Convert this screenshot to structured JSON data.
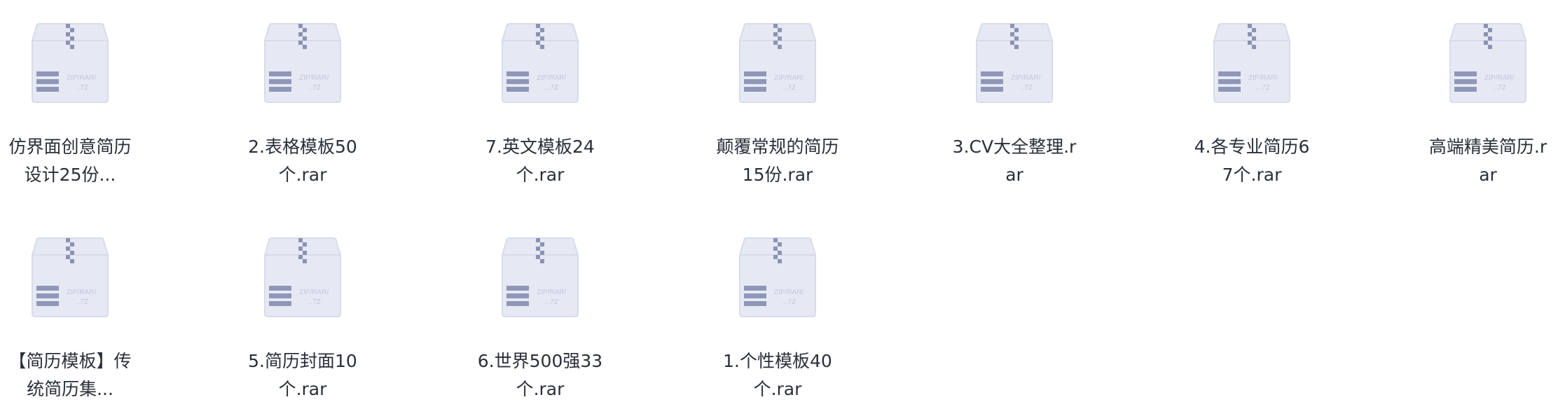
{
  "files": [
    {
      "name": "仿界面创意简历设计25份...",
      "icon": "archive-zip-icon",
      "icon_text": "ZIP/RAR/\n...7Z"
    },
    {
      "name": "2.表格模板50个.rar",
      "icon": "archive-zip-icon",
      "icon_text": "ZIP/RAR/\n...7Z"
    },
    {
      "name": "7.英文模板24个.rar",
      "icon": "archive-zip-icon",
      "icon_text": "ZIP/RAR/\n...7Z"
    },
    {
      "name": "颠覆常规的简历15份.rar",
      "icon": "archive-zip-icon",
      "icon_text": "ZIP/RAR/\n...7Z"
    },
    {
      "name": "3.CV大全整理.rar",
      "icon": "archive-zip-icon",
      "icon_text": "ZIP/RAR/\n...7Z"
    },
    {
      "name": "4.各专业简历67个.rar",
      "icon": "archive-zip-icon",
      "icon_text": "ZIP/RAR/\n...7Z"
    },
    {
      "name": "高端精美简历.rar",
      "icon": "archive-zip-icon",
      "icon_text": "ZIP/RAR/\n...7Z"
    },
    {
      "name": "【简历模板】传统简历集...",
      "icon": "archive-zip-icon",
      "icon_text": "ZIP/RAR/\n...7Z"
    },
    {
      "name": "5.简历封面10个.rar",
      "icon": "archive-zip-icon",
      "icon_text": "ZIP/RAR/\n...7Z"
    },
    {
      "name": "6.世界500强33个.rar",
      "icon": "archive-zip-icon",
      "icon_text": "ZIP/RAR/\n...7Z"
    },
    {
      "name": "1.个性模板40个.rar",
      "icon": "archive-zip-icon",
      "icon_text": "ZIP/RAR/\n...7Z"
    }
  ],
  "colors": {
    "icon_body": "#e6e9f4",
    "icon_edge": "#d7dbea",
    "icon_stripe": "#8f97b8",
    "icon_zip": "#8b93b3",
    "label_text": "#2b2f3a"
  }
}
